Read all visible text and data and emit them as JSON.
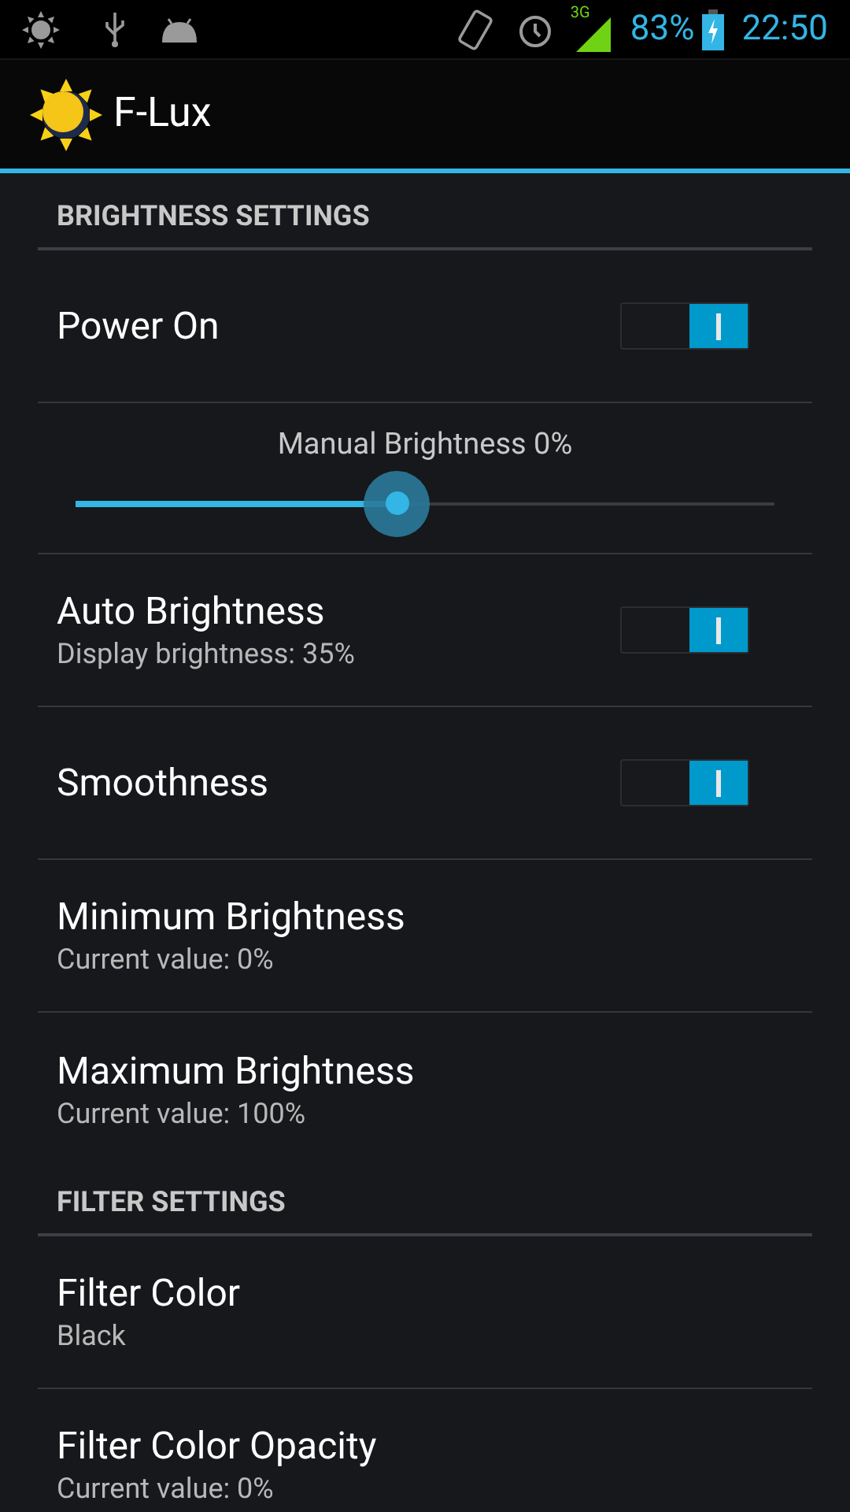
{
  "status_bar": {
    "battery": "83%",
    "time": "22:50",
    "network": "3G"
  },
  "action_bar": {
    "title": "F-Lux"
  },
  "sections": [
    {
      "title": "BRIGHTNESS SETTINGS",
      "items": [
        {
          "kind": "switch",
          "title": "Power On",
          "on": true
        },
        {
          "kind": "slider",
          "title": "Manual Brightness 0%",
          "level": 0.46
        },
        {
          "kind": "switch",
          "title": "Auto Brightness",
          "summary": "Display brightness: 35%",
          "on": true
        },
        {
          "kind": "switch",
          "title": "Smoothness",
          "on": true
        },
        {
          "kind": "text",
          "title": "Minimum Brightness",
          "summary": "Current value: 0%"
        },
        {
          "kind": "text",
          "title": "Maximum Brightness",
          "summary": "Current value: 100%"
        }
      ]
    },
    {
      "title": "FILTER SETTINGS",
      "items": [
        {
          "kind": "text",
          "title": "Filter Color",
          "summary": "Black"
        },
        {
          "kind": "text",
          "title": "Filter Color Opacity",
          "summary": "Current value: 0%"
        }
      ]
    }
  ]
}
